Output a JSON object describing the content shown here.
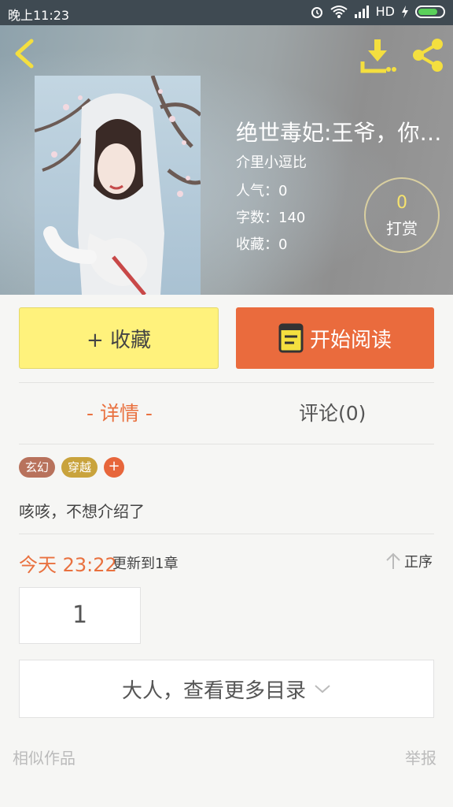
{
  "status_bar": {
    "time": "晚上11:23",
    "network": "HD"
  },
  "header": {
    "icons": [
      "back-arrow-icon",
      "download-icon",
      "share-icon"
    ],
    "title": "绝世毒妃:王爷，你轻…",
    "author": "介里小逗比",
    "popularity_label": "人气：0",
    "word_count_label": "字数：140",
    "favorites_label": "收藏：0",
    "reward": {
      "count": "0",
      "label": "打赏"
    }
  },
  "actions": {
    "collect_label": "+ 收藏",
    "read_label": "开始阅读"
  },
  "tabs": {
    "detail": "- 详情 -",
    "comment": "评论(0)"
  },
  "tags": [
    {
      "label": "玄幻",
      "color": "#b8725c"
    },
    {
      "label": "穿越",
      "color": "#c9a33c"
    }
  ],
  "tag_add": "+",
  "intro": "咳咳，不想介绍了",
  "update": {
    "time": "今天 23:22",
    "text": "更新到1章",
    "sort_label": "正序"
  },
  "chapter": {
    "number": "1"
  },
  "more_catalog": "大人，查看更多目录",
  "footer": {
    "similar": "相似作品",
    "report": "举报"
  },
  "colors": {
    "accent": "#ea6b3d",
    "collect_bg": "#fff27c",
    "reward_num": "#f6e36e"
  }
}
